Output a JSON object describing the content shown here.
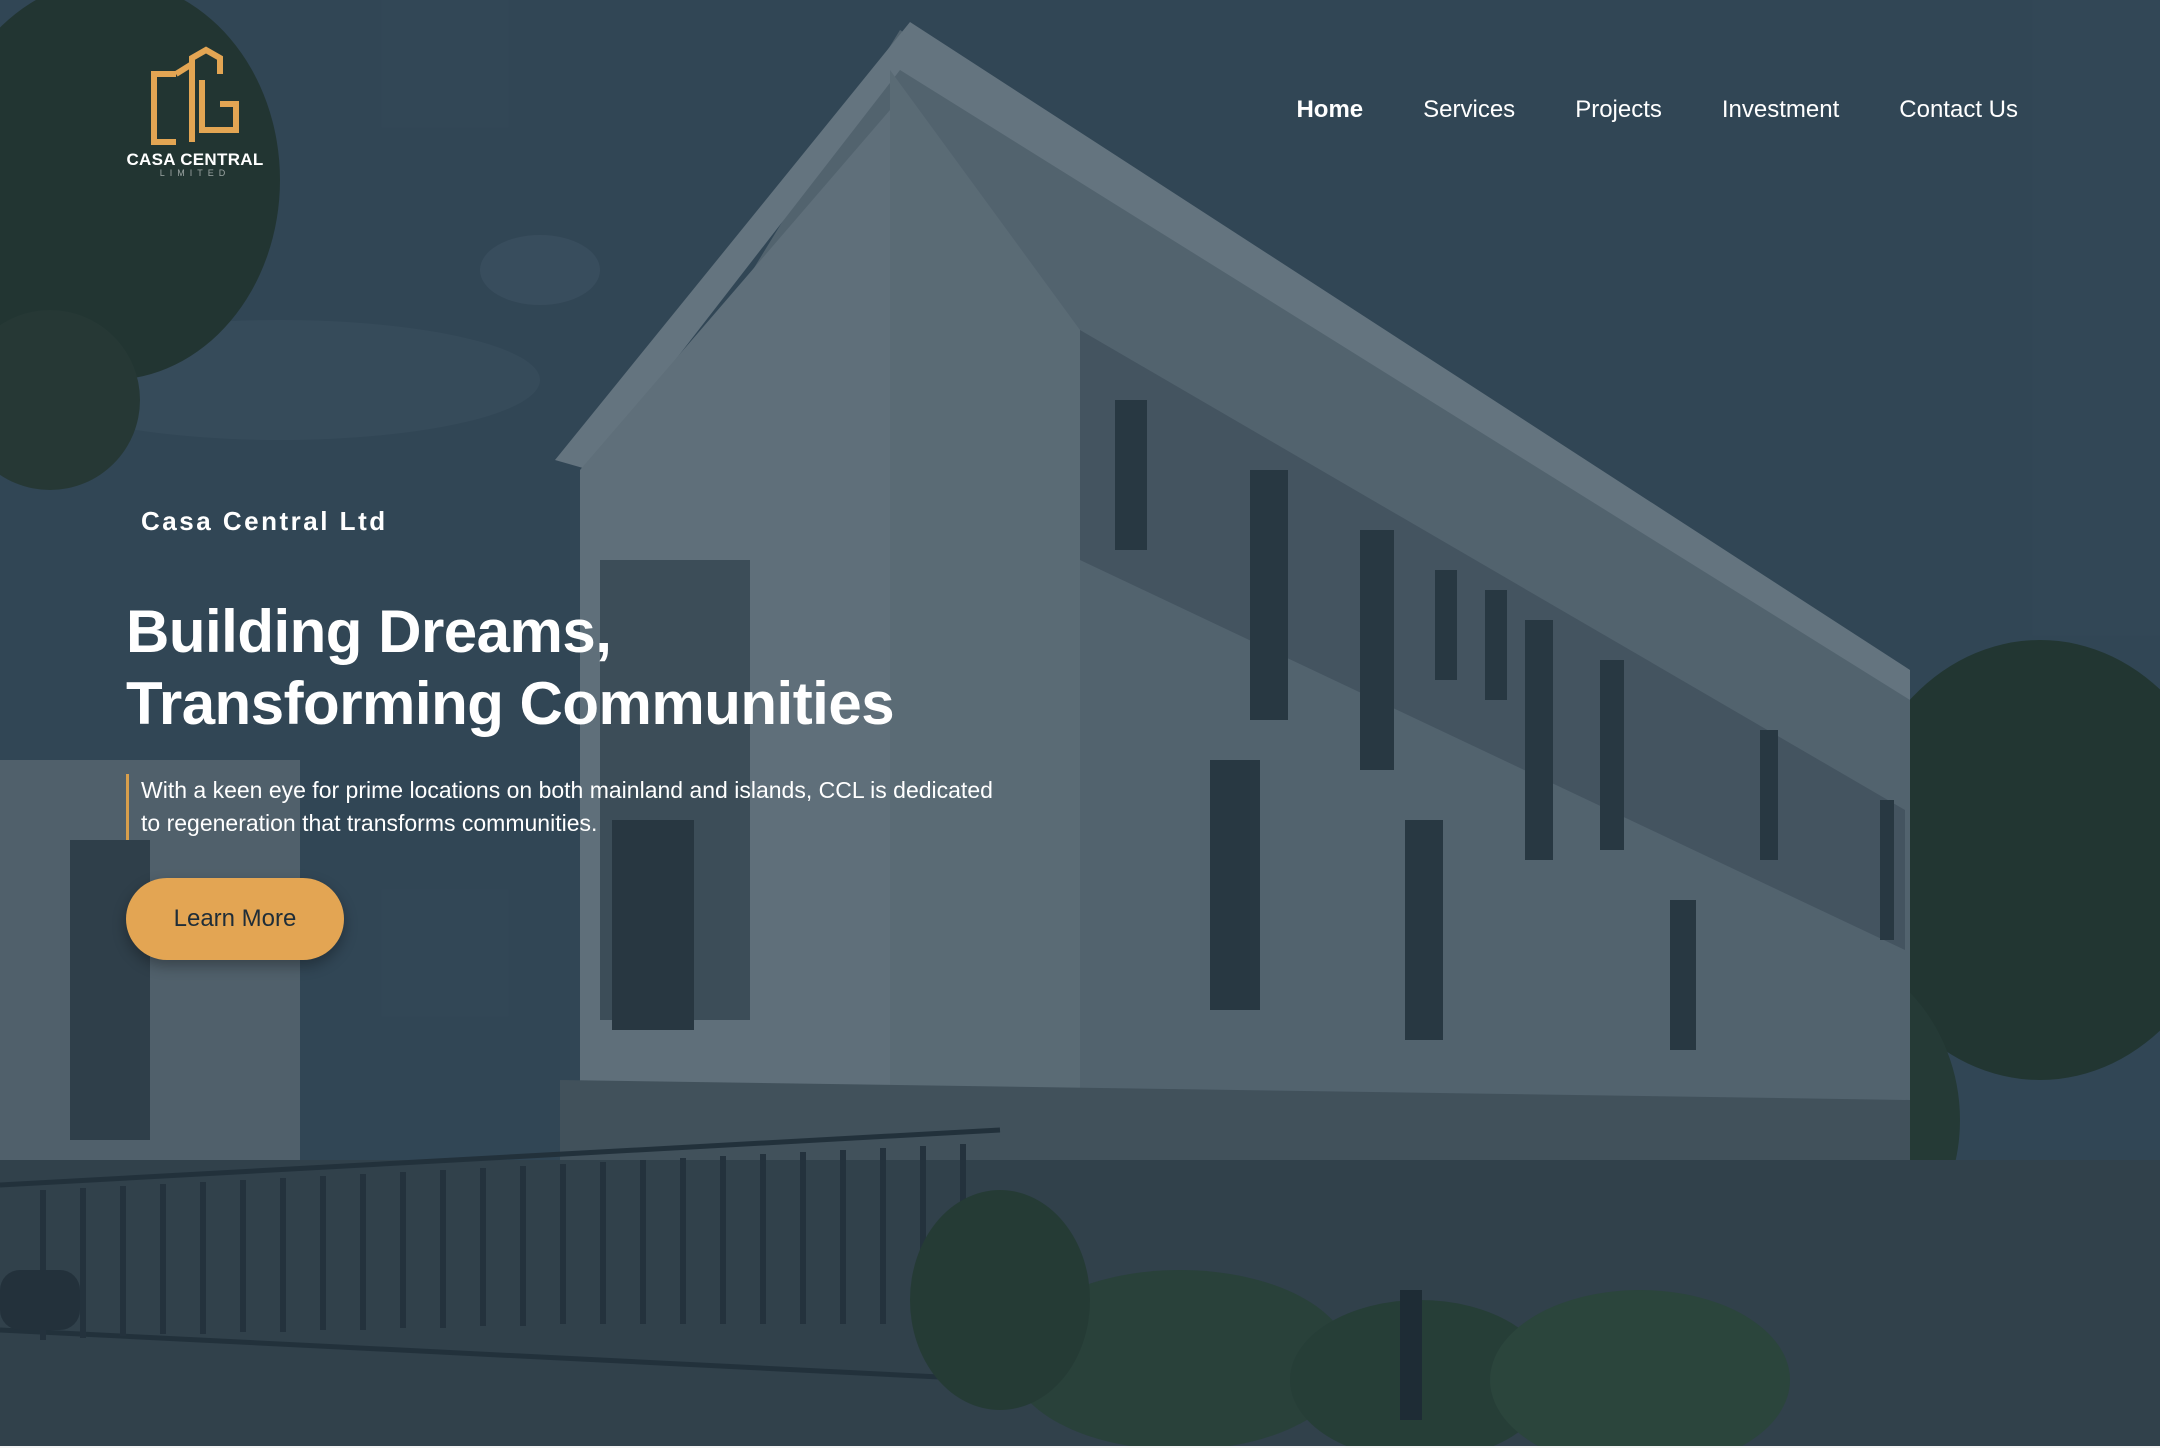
{
  "brand": {
    "logo_icon": "building-logo-icon",
    "name": "CASA CENTRAL",
    "subname": "LIMITED",
    "accent_color": "#e3a553"
  },
  "nav": {
    "items": [
      {
        "label": "Home",
        "active": true
      },
      {
        "label": "Services",
        "active": false
      },
      {
        "label": "Projects",
        "active": false
      },
      {
        "label": "Investment",
        "active": false
      },
      {
        "label": "Contact Us",
        "active": false
      }
    ]
  },
  "hero": {
    "eyebrow": "Casa Central Ltd",
    "headline_line1": "Building Dreams,",
    "headline_line2": "Transforming Communities",
    "description_line1": "With a keen eye for prime locations on both mainland and islands, CCL is dedicated",
    "description_line2": "to regeneration that transforms communities.",
    "cta_label": "Learn More",
    "background_image": "modern-apartment-building-photo"
  }
}
